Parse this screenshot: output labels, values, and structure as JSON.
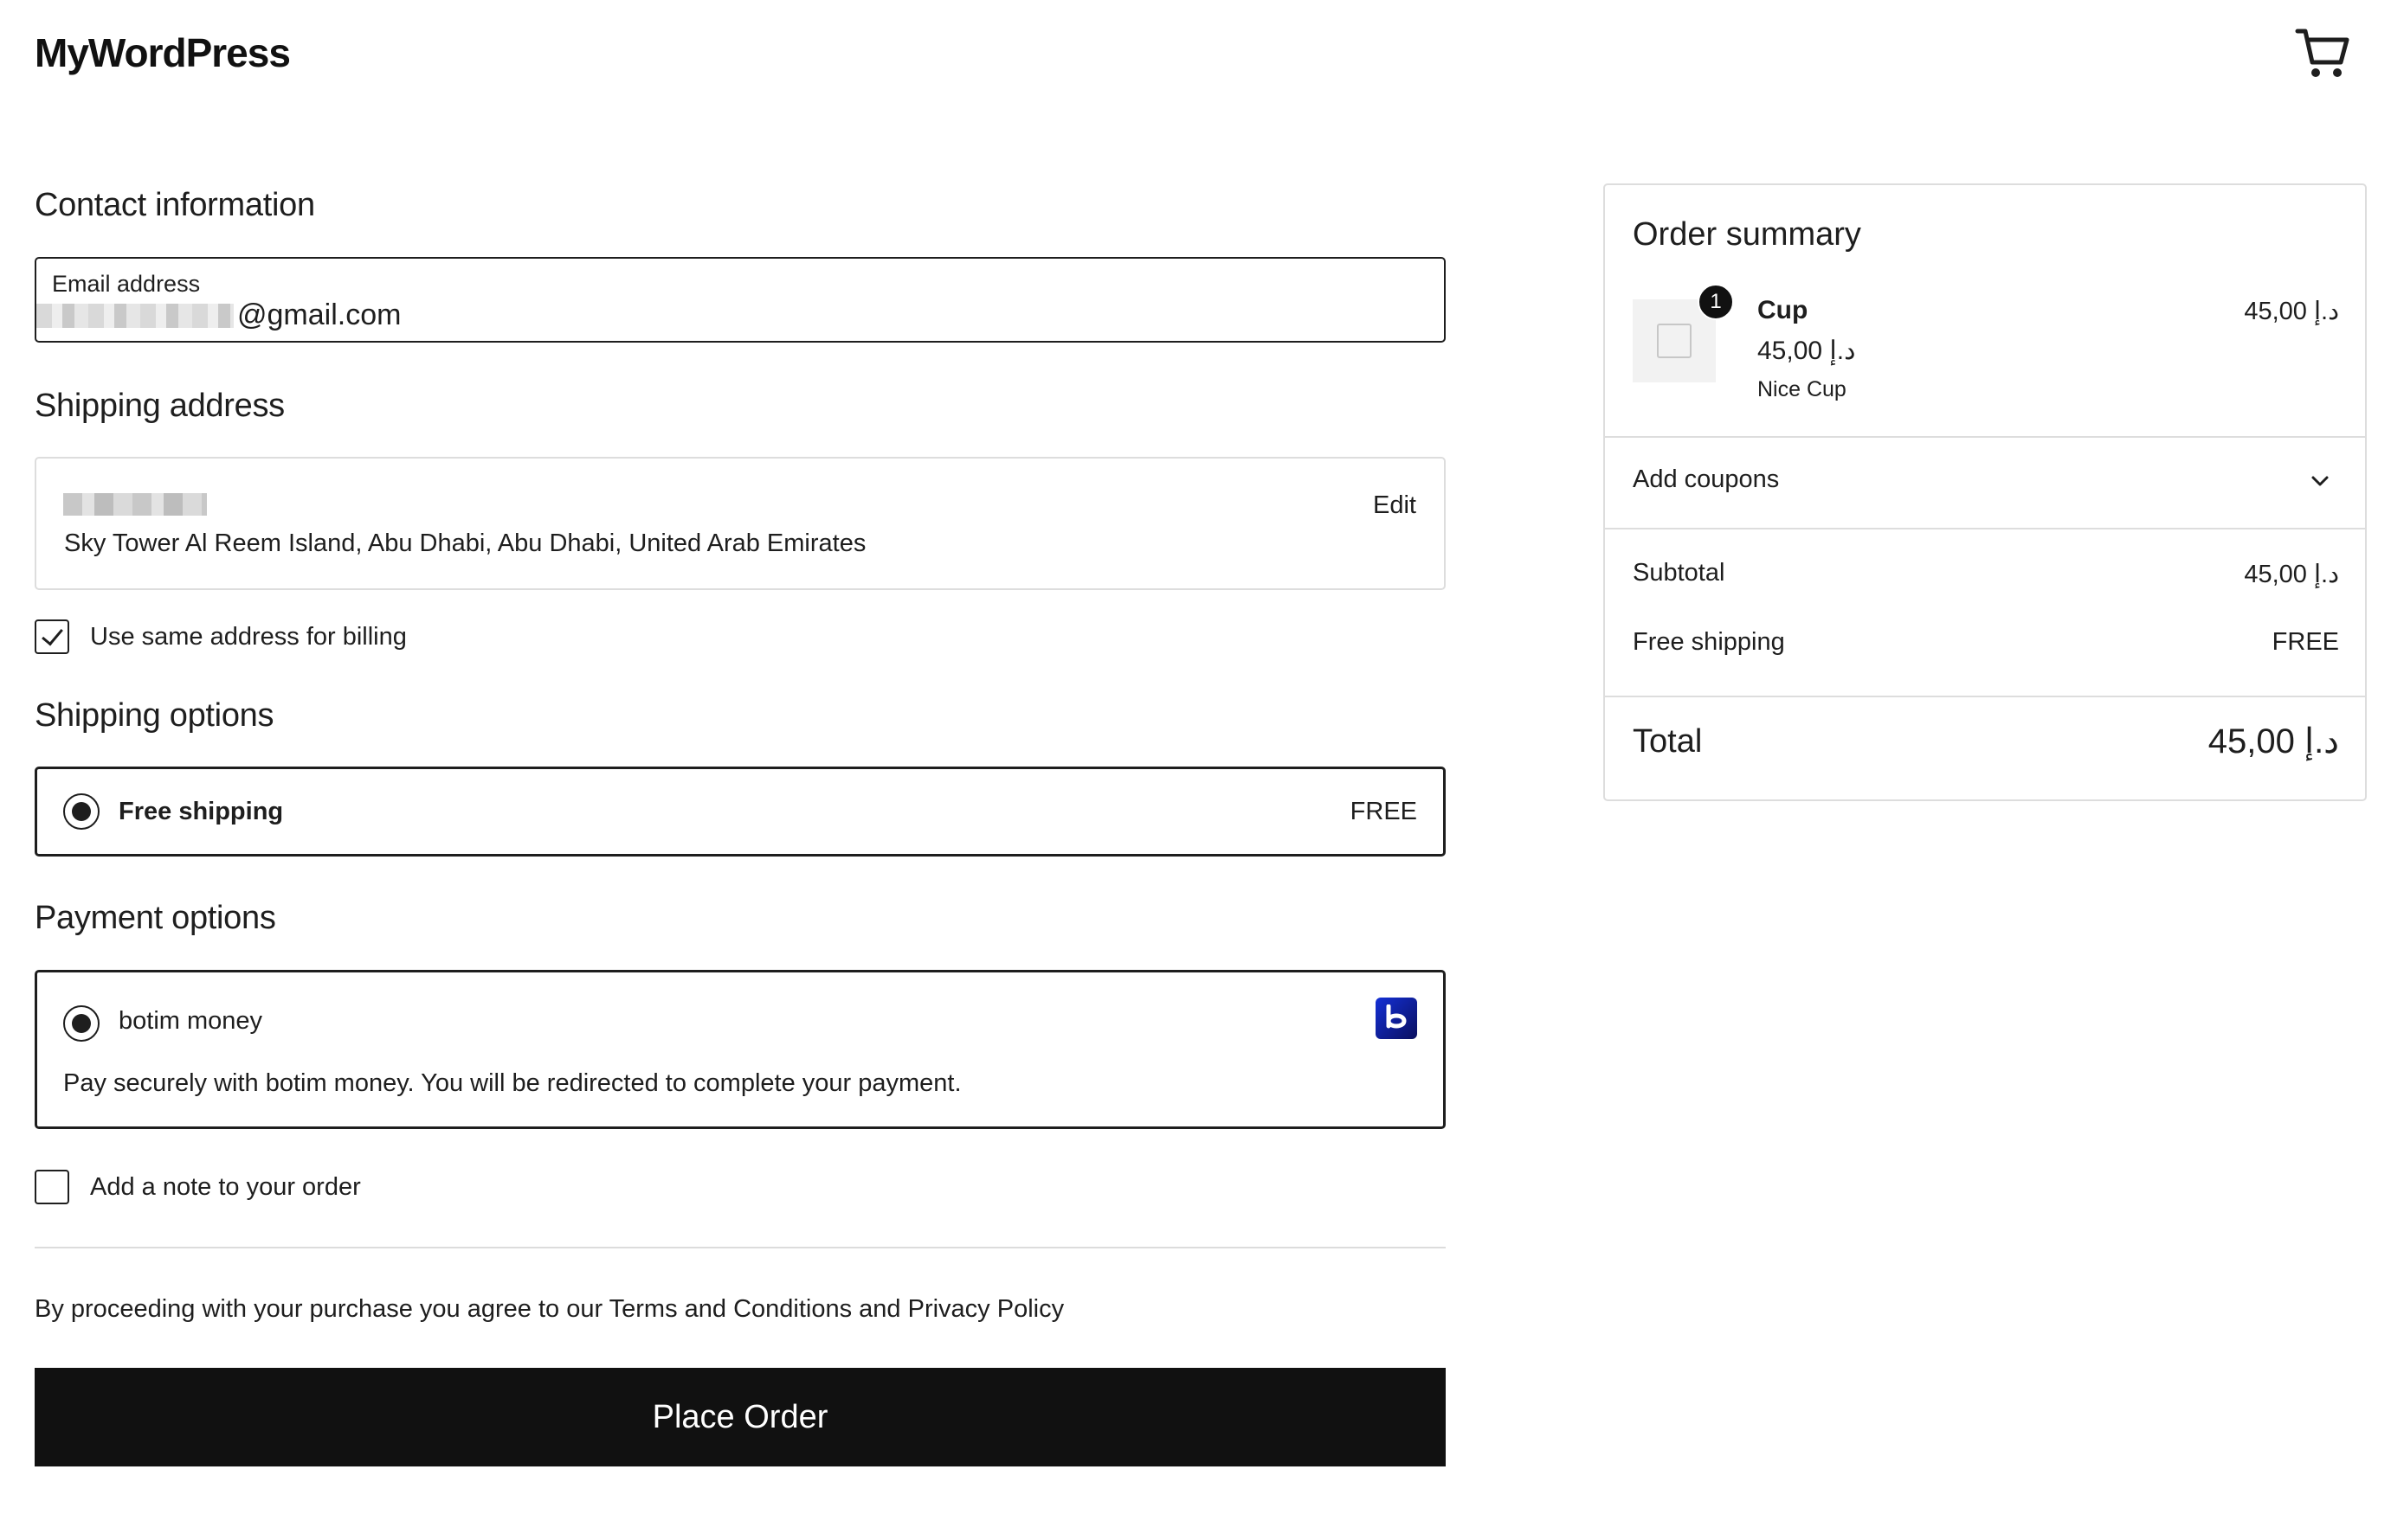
{
  "header": {
    "site_title": "MyWordPress",
    "cart_icon": "cart-icon"
  },
  "contact": {
    "heading": "Contact information",
    "email_label": "Email address",
    "email_suffix": "@gmail.com"
  },
  "shipping_address": {
    "heading": "Shipping address",
    "address_line": "Sky Tower Al Reem Island, Abu Dhabi, Abu Dhabi, United Arab Emirates",
    "edit_label": "Edit"
  },
  "billing": {
    "same_address_label": "Use same address for billing",
    "checked": true
  },
  "shipping_options": {
    "heading": "Shipping options",
    "option_label": "Free shipping",
    "option_price": "FREE"
  },
  "payment_options": {
    "heading": "Payment options",
    "method_label": "botim money",
    "method_description": "Pay securely with botim money. You will be redirected to complete your payment.",
    "logo_letter": "b",
    "logo_color": "#1430d6"
  },
  "order_note": {
    "label": "Add a note to your order",
    "checked": false
  },
  "terms_text": "By proceeding with your purchase you agree to our Terms and Conditions and Privacy Policy",
  "place_order_label": "Place Order",
  "summary": {
    "heading": "Order summary",
    "item": {
      "quantity": "1",
      "name": "Cup",
      "unit_price": "45,00 د.إ",
      "description": "Nice Cup",
      "line_total": "45,00 د.إ"
    },
    "coupons_label": "Add coupons",
    "subtotal_label": "Subtotal",
    "subtotal_value": "45,00 د.إ",
    "shipping_label": "Free shipping",
    "shipping_value": "FREE",
    "total_label": "Total",
    "total_value": "45,00 د.إ"
  }
}
